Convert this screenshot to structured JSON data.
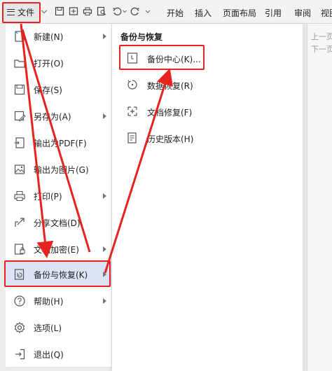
{
  "toolbar": {
    "file_label": "文件",
    "ribbon_tabs": [
      "开始",
      "插入",
      "页面布局",
      "引用",
      "审阅",
      "视图"
    ]
  },
  "nav_right": {
    "prev_label": "上一页",
    "next_label": "下一页"
  },
  "file_menu": {
    "items": [
      {
        "label": "新建(N)",
        "icon": "new-doc-icon",
        "has_submenu": true
      },
      {
        "label": "打开(O)",
        "icon": "folder-open-icon",
        "has_submenu": false
      },
      {
        "label": "保存(S)",
        "icon": "save-icon",
        "has_submenu": false
      },
      {
        "label": "另存为(A)",
        "icon": "save-as-icon",
        "has_submenu": true
      },
      {
        "label": "输出为PDF(F)",
        "icon": "export-pdf-icon",
        "has_submenu": false
      },
      {
        "label": "输出为图片(G)",
        "icon": "export-image-icon",
        "has_submenu": false
      },
      {
        "label": "打印(P)",
        "icon": "printer-icon",
        "has_submenu": true
      },
      {
        "label": "分享文档(D)",
        "icon": "share-icon",
        "has_submenu": false
      },
      {
        "label": "文档加密(E)",
        "icon": "encrypt-doc-icon",
        "has_submenu": true
      },
      {
        "label": "备份与恢复(K)",
        "icon": "backup-icon",
        "has_submenu": true,
        "active": true
      },
      {
        "label": "帮助(H)",
        "icon": "help-icon",
        "has_submenu": true
      },
      {
        "label": "选项(L)",
        "icon": "gear-icon",
        "has_submenu": false
      },
      {
        "label": "退出(Q)",
        "icon": "exit-icon",
        "has_submenu": false
      }
    ]
  },
  "submenu": {
    "title": "备份与恢复",
    "items": [
      {
        "label": "备份中心(K)...",
        "icon": "backup-center-icon"
      },
      {
        "label": "数据恢复(R)",
        "icon": "data-recovery-icon"
      },
      {
        "label": "文档修复(F)",
        "icon": "doc-repair-icon"
      },
      {
        "label": "历史版本(H)",
        "icon": "history-version-icon"
      }
    ]
  },
  "colors": {
    "highlight_red": "#e8221e",
    "active_bg": "#dbe3f5",
    "menu_bg": "#ffffff"
  }
}
